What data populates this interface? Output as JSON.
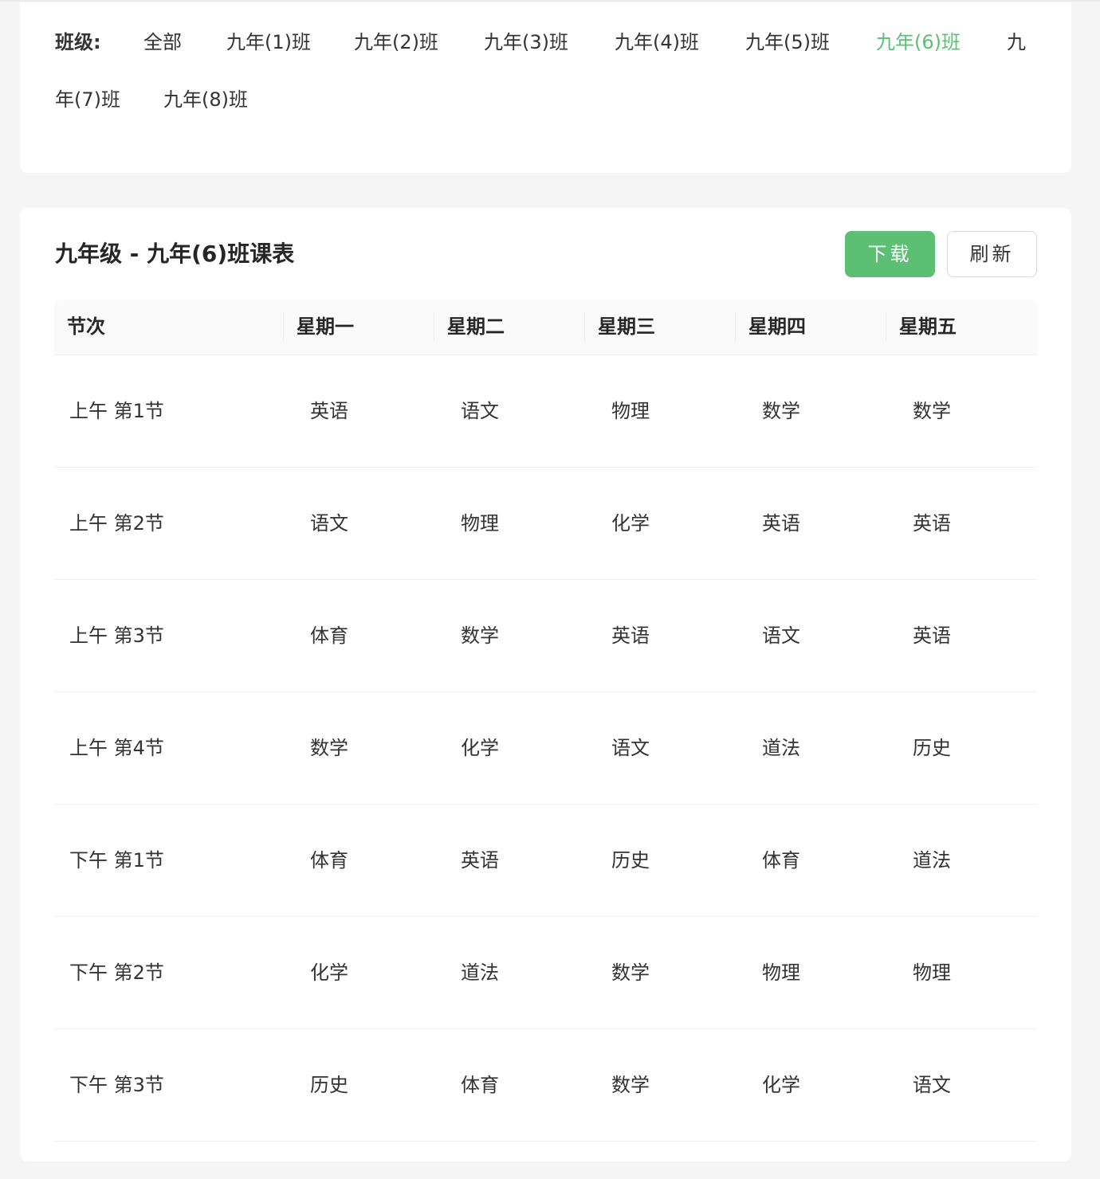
{
  "filter": {
    "label": "班级:",
    "classes": [
      {
        "label": "全部",
        "active": false
      },
      {
        "label": "九年(1)班",
        "active": false
      },
      {
        "label": "九年(2)班",
        "active": false
      },
      {
        "label": "九年(3)班",
        "active": false
      },
      {
        "label": "九年(4)班",
        "active": false
      },
      {
        "label": "九年(5)班",
        "active": false
      },
      {
        "label": "九年(6)班",
        "active": true
      },
      {
        "label": "九",
        "active": false
      },
      {
        "label": "年(7)班",
        "active": false
      },
      {
        "label": "九年(8)班",
        "active": false
      }
    ]
  },
  "schedule": {
    "title": "九年级 - 九年(6)班课表",
    "download_label": "下载",
    "refresh_label": "刷新",
    "headers": [
      "节次",
      "星期一",
      "星期二",
      "星期三",
      "星期四",
      "星期五"
    ],
    "rows": [
      {
        "period": "上午 第1节",
        "subjects": [
          "英语",
          "语文",
          "物理",
          "数学",
          "数学"
        ]
      },
      {
        "period": "上午 第2节",
        "subjects": [
          "语文",
          "物理",
          "化学",
          "英语",
          "英语"
        ]
      },
      {
        "period": "上午 第3节",
        "subjects": [
          "体育",
          "数学",
          "英语",
          "语文",
          "英语"
        ]
      },
      {
        "period": "上午 第4节",
        "subjects": [
          "数学",
          "化学",
          "语文",
          "道法",
          "历史"
        ]
      },
      {
        "period": "下午 第1节",
        "subjects": [
          "体育",
          "英语",
          "历史",
          "体育",
          "道法"
        ]
      },
      {
        "period": "下午 第2节",
        "subjects": [
          "化学",
          "道法",
          "数学",
          "物理",
          "物理"
        ]
      },
      {
        "period": "下午 第3节",
        "subjects": [
          "历史",
          "体育",
          "数学",
          "化学",
          "语文"
        ]
      }
    ]
  },
  "colors": {
    "accent": "#5cbf73",
    "page_background": "#f5f5f5",
    "card_background": "#ffffff",
    "header_background": "#fafafa"
  }
}
